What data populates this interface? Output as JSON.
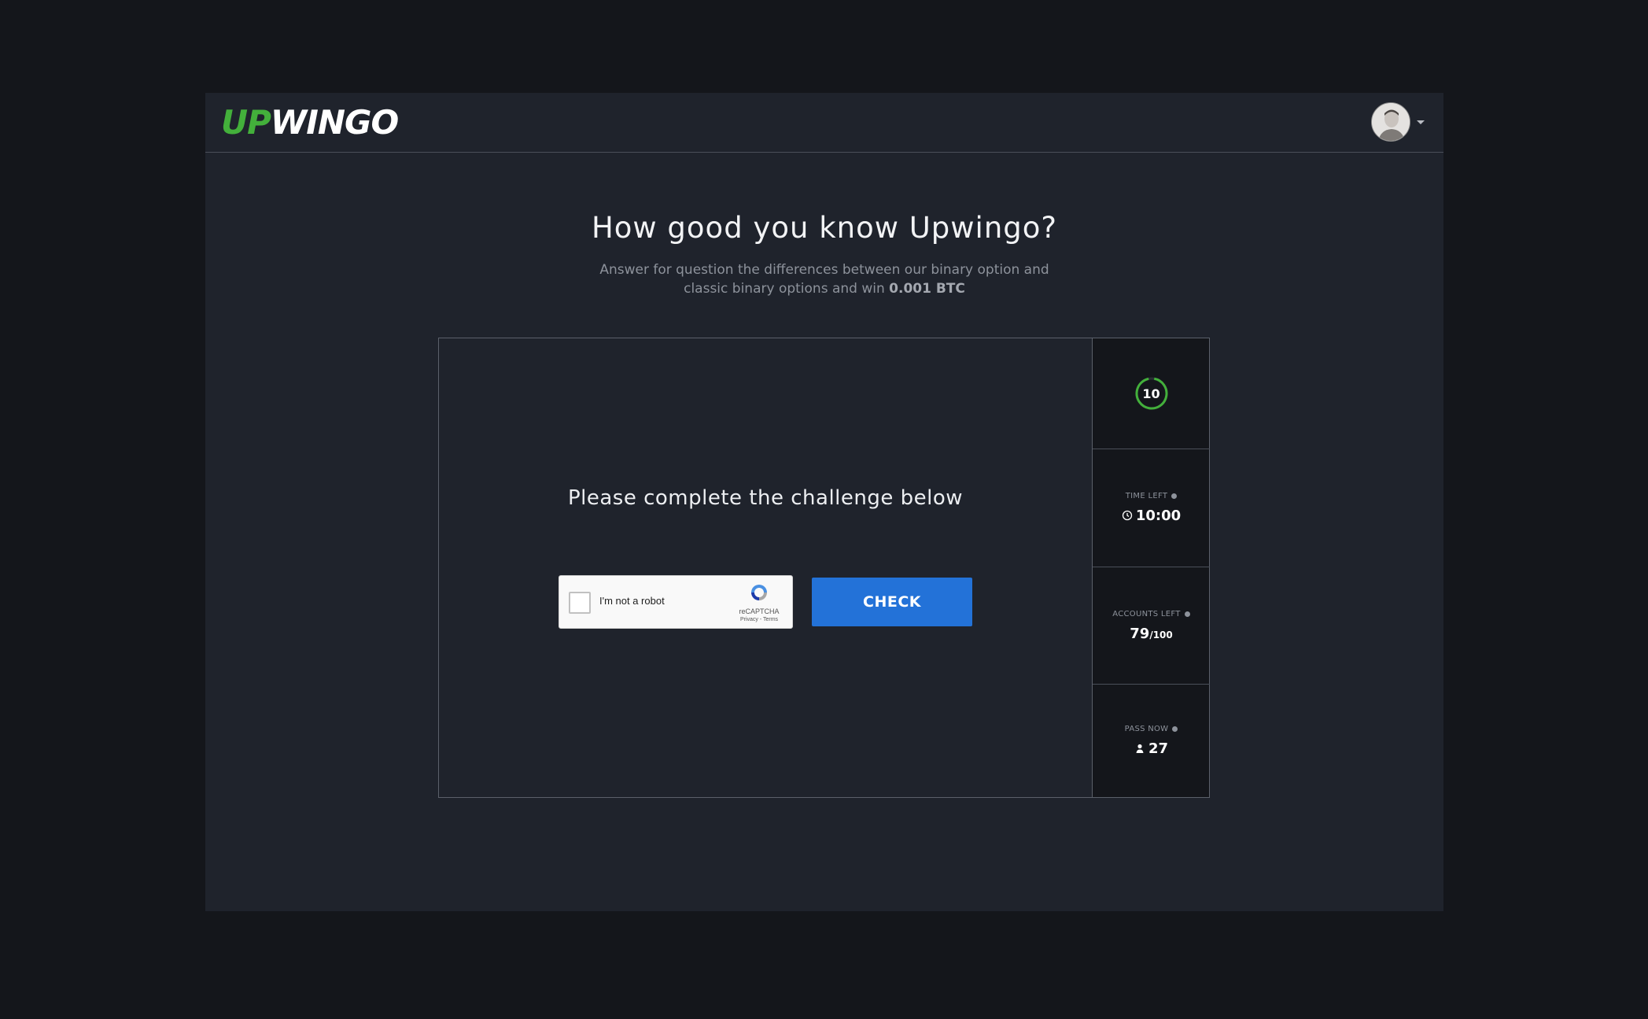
{
  "brand": {
    "logo_up": "UP",
    "logo_wingo": "WINGO",
    "accent_color": "#43b03b"
  },
  "hero": {
    "title": "How good you know Upwingo?",
    "subtitle_line": "Answer for question the differences between our binary option and classic binary options and win",
    "subtitle_reward": "0.001 BTC"
  },
  "challenge": {
    "prompt": "Please complete the challenge below",
    "captcha_label": "I'm not a robot",
    "captcha_brand": "reCAPTCHA",
    "captcha_links": "Privacy - Terms",
    "check_button": "CHECK",
    "button_color": "#2372d8"
  },
  "stats": {
    "countdown": "10",
    "time_left_label": "TIME LEFT",
    "time_left_value": "10:00",
    "accounts_left_label": "ACCOUNTS LEFT",
    "accounts_left_value": "79",
    "accounts_total": "/100",
    "pass_now_label": "PASS NOW",
    "pass_now_value": "27"
  },
  "icons": {
    "timer_ring": "progress-ring-icon",
    "clock": "clock-icon",
    "person": "person-icon",
    "info": "info-icon",
    "caret": "chevron-down-icon"
  }
}
